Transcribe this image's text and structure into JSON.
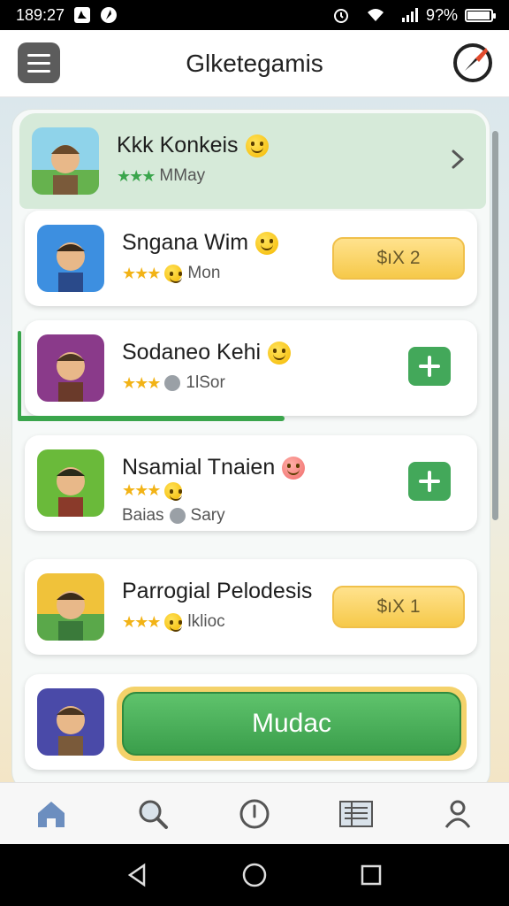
{
  "status_bar": {
    "time": "189:27",
    "battery_text": "9?%",
    "battery_level": 0.9
  },
  "app_bar": {
    "title": "Glketegamis"
  },
  "colors": {
    "accent_green": "#3aa54c",
    "button_yellow": "#f6c94a",
    "star_gold": "#f2b316"
  },
  "list": [
    {
      "title": "Kkk Konkeis",
      "subtitle": "MMay",
      "action": "chevron"
    },
    {
      "title": "Sngana Wim",
      "subtitle": "Mon",
      "action": "button",
      "button_label": "$ıX 2"
    },
    {
      "title": "Sodaneo Kehi",
      "subtitle": "1lSor",
      "action": "plus"
    },
    {
      "title": "Nsamial Tnaien",
      "subtitle_left": "Baias",
      "subtitle_right": "Sary",
      "action": "plus"
    },
    {
      "title": "Parrogial Pelodesis",
      "subtitle": "lklioc",
      "action": "button",
      "button_label": "$ıX 1"
    },
    {
      "action": "big_button",
      "button_label": "Mudac"
    }
  ],
  "progress": {
    "value": 0.58
  },
  "bottom_nav": [
    "home-icon",
    "search-icon",
    "info-icon",
    "list-icon",
    "profile-icon"
  ],
  "system_nav": [
    "back-icon",
    "home-circle-icon",
    "recents-icon"
  ]
}
